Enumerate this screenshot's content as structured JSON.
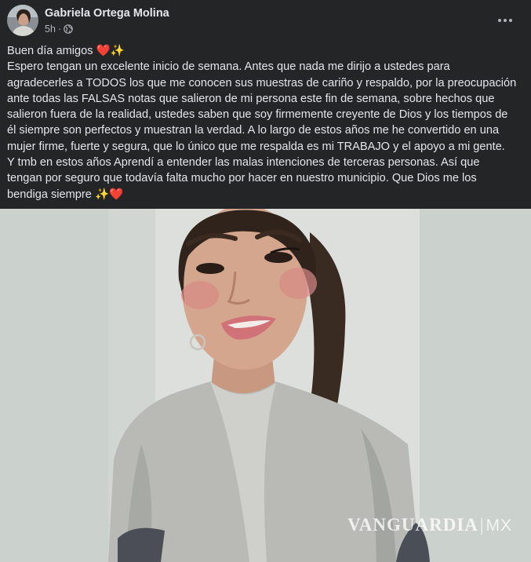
{
  "post": {
    "author": "Gabriela Ortega Molina",
    "time": "5h",
    "visibility_icon": "globe-icon",
    "more_icon": "more-options-icon",
    "lines": [
      "Buen día amigos ❤️✨",
      "Espero tengan un excelente inicio de semana. Antes que nada me dirijo a ustedes para",
      "agradecerles a TODOS los que me conocen sus muestras de cariño y respaldo, por la preocupación",
      "ante todas las FALSAS notas que salieron de mi persona este fin de semana, sobre hechos que",
      "salieron fuera de la realidad, ustedes saben que soy firmemente creyente de Dios y los tiempos de",
      "él siempre son perfectos y muestran la verdad. A lo largo de estos años me he convertido en una",
      "mujer firme, fuerte  y segura, que lo único que me respalda es mi TRABAJO y el apoyo a mi gente.",
      "Y tmb en estos años Aprendí a entender las malas intenciones de terceras personas.  Así que",
      "tengan por seguro que todavía falta mucho por hacer en nuestro municipio. Que Dios me los",
      "bendiga siempre ✨❤️"
    ]
  },
  "photo": {
    "description_icon": "selfie-photo",
    "watermark": {
      "brand": "VANGUARDIA",
      "separator": "|",
      "suffix": "MX"
    }
  },
  "colors": {
    "background": "#242526",
    "text_primary": "#e4e6eb",
    "text_secondary": "#b0b3b8",
    "photo_backdrop": "#ced5d1"
  }
}
